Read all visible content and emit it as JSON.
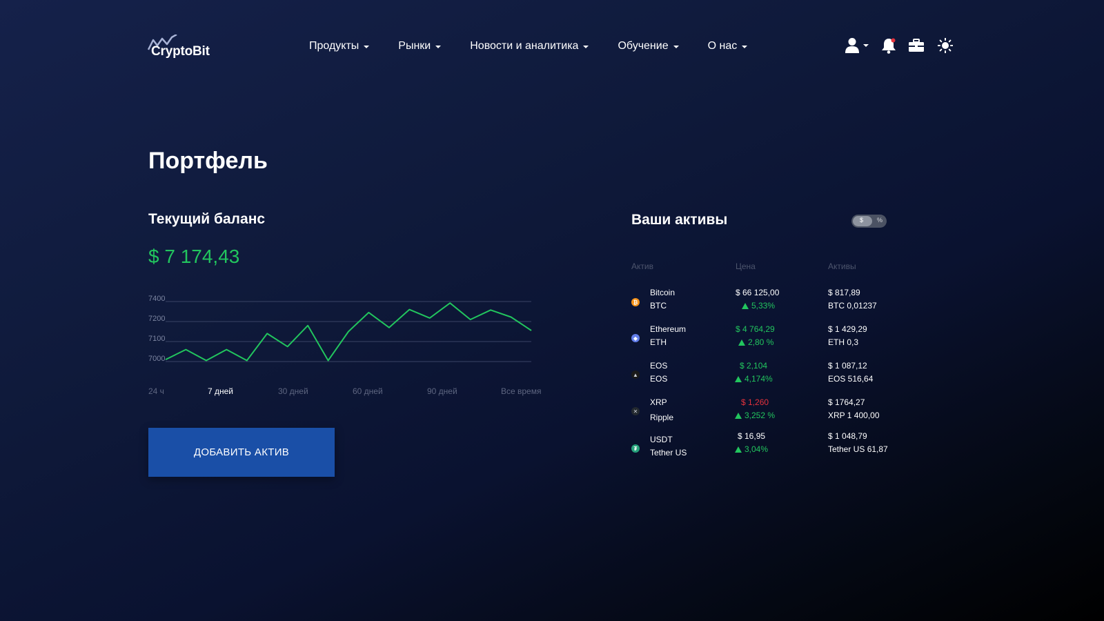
{
  "brand": {
    "name": "CryptoBit"
  },
  "nav": [
    "Продукты",
    "Рынки",
    "Новости и аналитика",
    "Обучение",
    "О нас"
  ],
  "header_icons": [
    "user-icon",
    "bell-icon",
    "briefcase-icon",
    "sun-icon"
  ],
  "page": {
    "title": "Портфель"
  },
  "balance": {
    "title": "Текущий баланс",
    "value": "$ 7 174,43",
    "color": "#22c55e"
  },
  "chart_data": {
    "type": "line",
    "title": "",
    "xlabel": "",
    "ylabel": "",
    "ylim": [
      6980,
      7400
    ],
    "yticks": [
      7400,
      7200,
      7100,
      7000
    ],
    "grid": true,
    "line_color": "#22c55e",
    "series": [
      {
        "values": [
          7010,
          7060,
          7005,
          7060,
          7005,
          7140,
          7075,
          7180,
          7005,
          7150,
          7290,
          7170,
          7320,
          7235,
          7385,
          7220,
          7315,
          7245,
          7155
        ]
      }
    ]
  },
  "ranges": [
    {
      "label": "24 ч",
      "active": false
    },
    {
      "label": "7 дней",
      "active": true
    },
    {
      "label": "30 дней",
      "active": false
    },
    {
      "label": "60 дней",
      "active": false
    },
    {
      "label": "90 дней",
      "active": false
    },
    {
      "label": "Все время",
      "active": false
    }
  ],
  "add_button": {
    "label": "ДОБАВИТЬ АКТИВ"
  },
  "assets": {
    "title": "Ваши активы",
    "toggle": {
      "left": "$",
      "right": "%"
    },
    "columns": [
      "Актив",
      "Цена",
      "Активы"
    ],
    "rows": [
      {
        "name": "Bitcoin",
        "ticker": "BTC",
        "price": "$ 66 125,00",
        "price_color": "white",
        "change": "5,33%",
        "value": "$ 817,89",
        "amount": "BTC 0,01237",
        "icon": "bitcoin-icon",
        "icon_color": "#f7931a",
        "glyph": "₿"
      },
      {
        "name": "Ethereum",
        "ticker": "ETH",
        "price": "$ 4 764,29",
        "price_color": "green",
        "change": "2,80 %",
        "value": "$ 1 429,29",
        "amount": "ETH 0,3",
        "icon": "ethereum-icon",
        "icon_color": "#627eea",
        "glyph": "◆"
      },
      {
        "name": "EOS",
        "ticker": "EOS",
        "price": "$ 2,104",
        "price_color": "green",
        "change": "4,174%",
        "value": "$ 1 087,12",
        "amount": "EOS 516,64",
        "icon": "eos-icon",
        "icon_color": "#1a1a1a",
        "glyph": "▲"
      },
      {
        "name": "XRP",
        "ticker": "Ripple",
        "price": "$ 1,260",
        "price_color": "red",
        "change": "3,252 %",
        "value": "$ 1764,27",
        "amount": "XRP 1 400,00",
        "icon": "xrp-icon",
        "icon_color": "#23292f",
        "glyph": "✕"
      },
      {
        "name": "USDT",
        "ticker": "Tether US",
        "price": "$ 16,95",
        "price_color": "white",
        "change": "3,04%",
        "value": "$ 1 048,79",
        "amount": "Tether US 61,87",
        "icon": "tether-icon",
        "icon_color": "#26a17b",
        "glyph": "₮"
      }
    ]
  }
}
